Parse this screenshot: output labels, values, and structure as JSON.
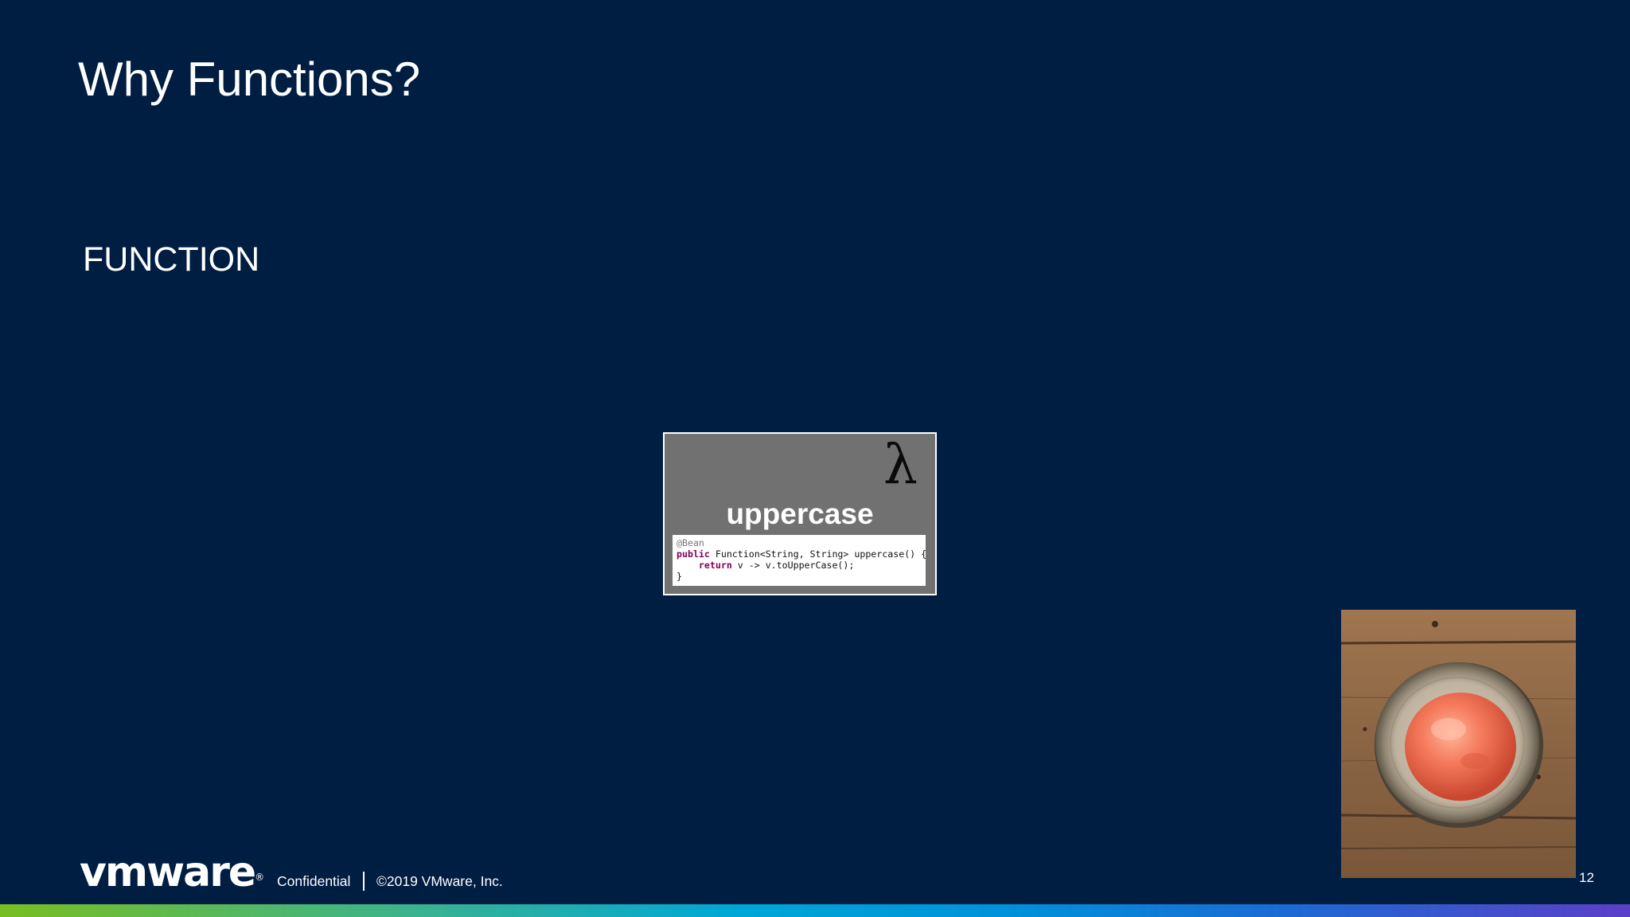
{
  "slide": {
    "title": "Why Functions?",
    "subtitle": "FUNCTION",
    "page_number": "12"
  },
  "function_card": {
    "lambda_symbol": "λ",
    "name": "uppercase",
    "code": {
      "annotation": "@Bean",
      "line1_keyword": "public",
      "line1_rest": " Function<String, String> uppercase() {",
      "line2_indent": "    ",
      "line2_keyword": "return",
      "line2_rest": " v -> v.toUpperCase();",
      "line3": "}"
    }
  },
  "photo": {
    "icon": "sorbet-bowl-photo"
  },
  "footer": {
    "logo": "vmware",
    "logo_reg": "®",
    "confidential": "Confidential",
    "copyright": "©2019 VMware, Inc."
  },
  "colors": {
    "background": "#001d42",
    "card": "#717171",
    "keyword": "#7f0055"
  }
}
